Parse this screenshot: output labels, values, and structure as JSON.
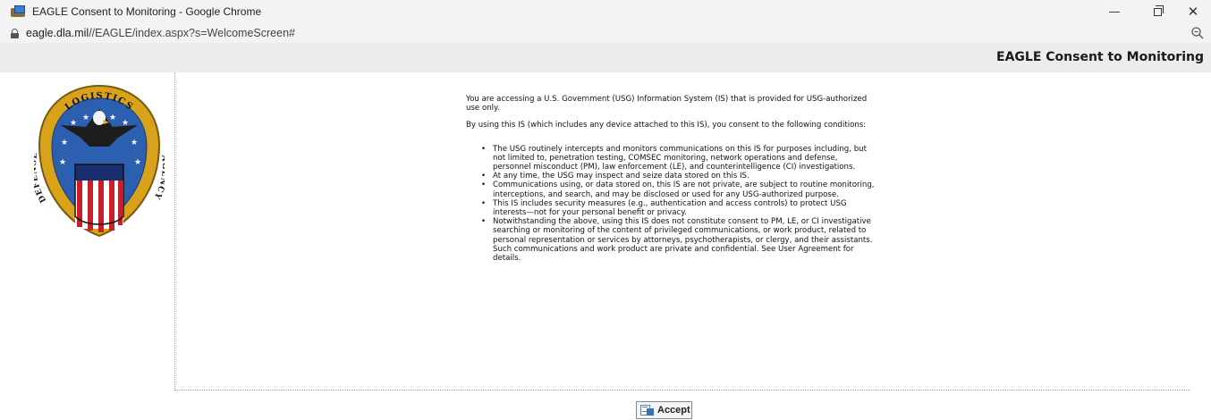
{
  "window": {
    "title": "EAGLE Consent to Monitoring - Google Chrome",
    "url_host": "eagle.dla.mil",
    "url_path": "//EAGLE/index.aspx?s=WelcomeScreen#",
    "controls": {
      "minimize": "—",
      "close": "✕"
    }
  },
  "page": {
    "title": "EAGLE Consent to Monitoring",
    "logo": {
      "top_text": "LOGISTICS",
      "left_text": "DEFENSE",
      "right_text": "AGENCY"
    }
  },
  "notice": {
    "intro": "You are accessing a U.S. Government (USG) Information System (IS) that is provided for USG-authorized use only.",
    "consent": "By using this IS (which includes any device attached to this IS), you consent to the following conditions:",
    "conditions": [
      "The USG routinely intercepts and monitors communications on this IS for purposes including, but not limited to, penetration testing, COMSEC monitoring, network operations and defense, personnel misconduct (PM), law enforcement (LE), and counterintelligence (CI) investigations.",
      "At any time, the USG may inspect and seize data stored on this IS.",
      "Communications using, or data stored on, this IS are not private, are subject to routine monitoring, interceptions, and search, and may be disclosed or used for any USG-authorized purpose.",
      "This IS includes security measures (e.g., authentication and access controls) to protect USG interests—not for your personal benefit or privacy.",
      "Notwithstanding the above, using this IS does not constitute consent to PM, LE, or CI investigative searching or monitoring of the content of privileged communications, or work product, related to personal representation or services by attorneys, psychotherapists, or clergy, and their assistants. Such communications and work product are private and confidential. See User Agreement for details."
    ]
  },
  "actions": {
    "accept_label": "Accept"
  }
}
